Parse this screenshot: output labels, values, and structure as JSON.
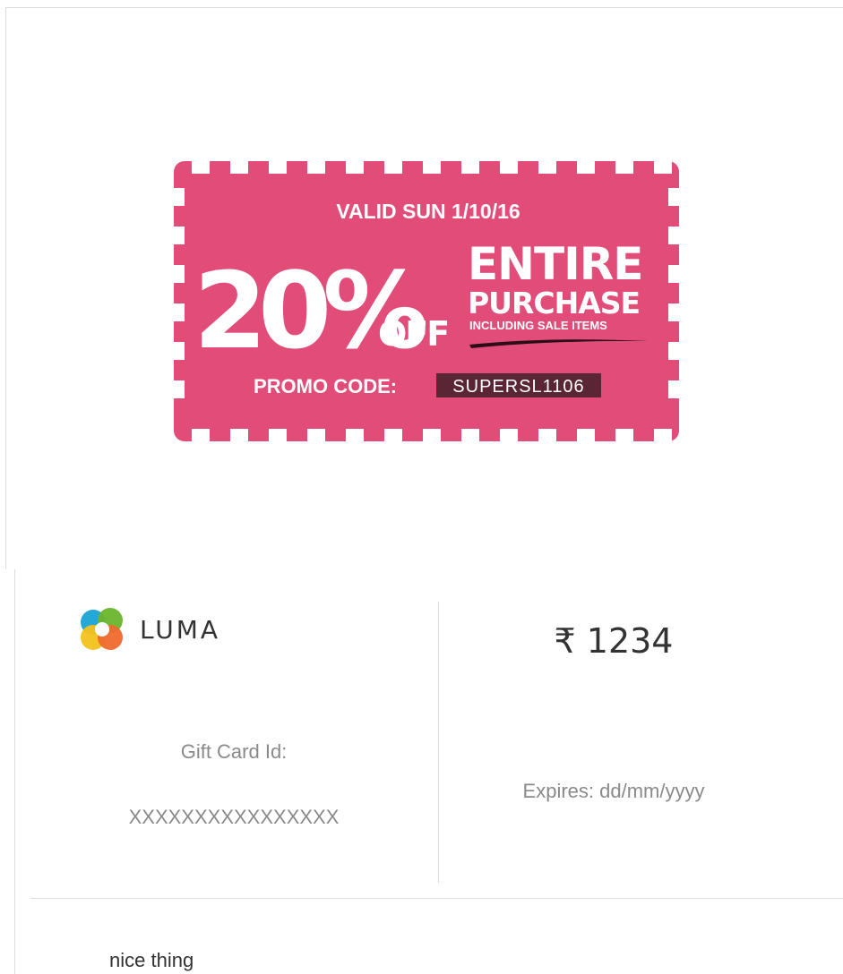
{
  "coupon": {
    "valid_text": "VALID SUN 1/10/16",
    "percent_text": "20%",
    "off_text": "OFF",
    "entire_text": "ENTIRE",
    "purchase_text": "PURCHASE",
    "including_text": "INCLUDING SALE ITEMS",
    "promo_label": "PROMO CODE:",
    "promo_code": "SUPERSL1106",
    "colors": {
      "background": "#e14d78",
      "code_box": "#5a2535",
      "text": "#ffffff"
    }
  },
  "card": {
    "logo_text": "LUMA",
    "amount": "₹ 1234",
    "gift_card_label": "Gift Card Id:",
    "gift_card_id": "XXXXXXXXXXXXXXXX",
    "expires": "Expires: dd/mm/yyyy",
    "message": "nice thing"
  },
  "icons": {
    "logo_icon": "luma-logo-icon"
  }
}
